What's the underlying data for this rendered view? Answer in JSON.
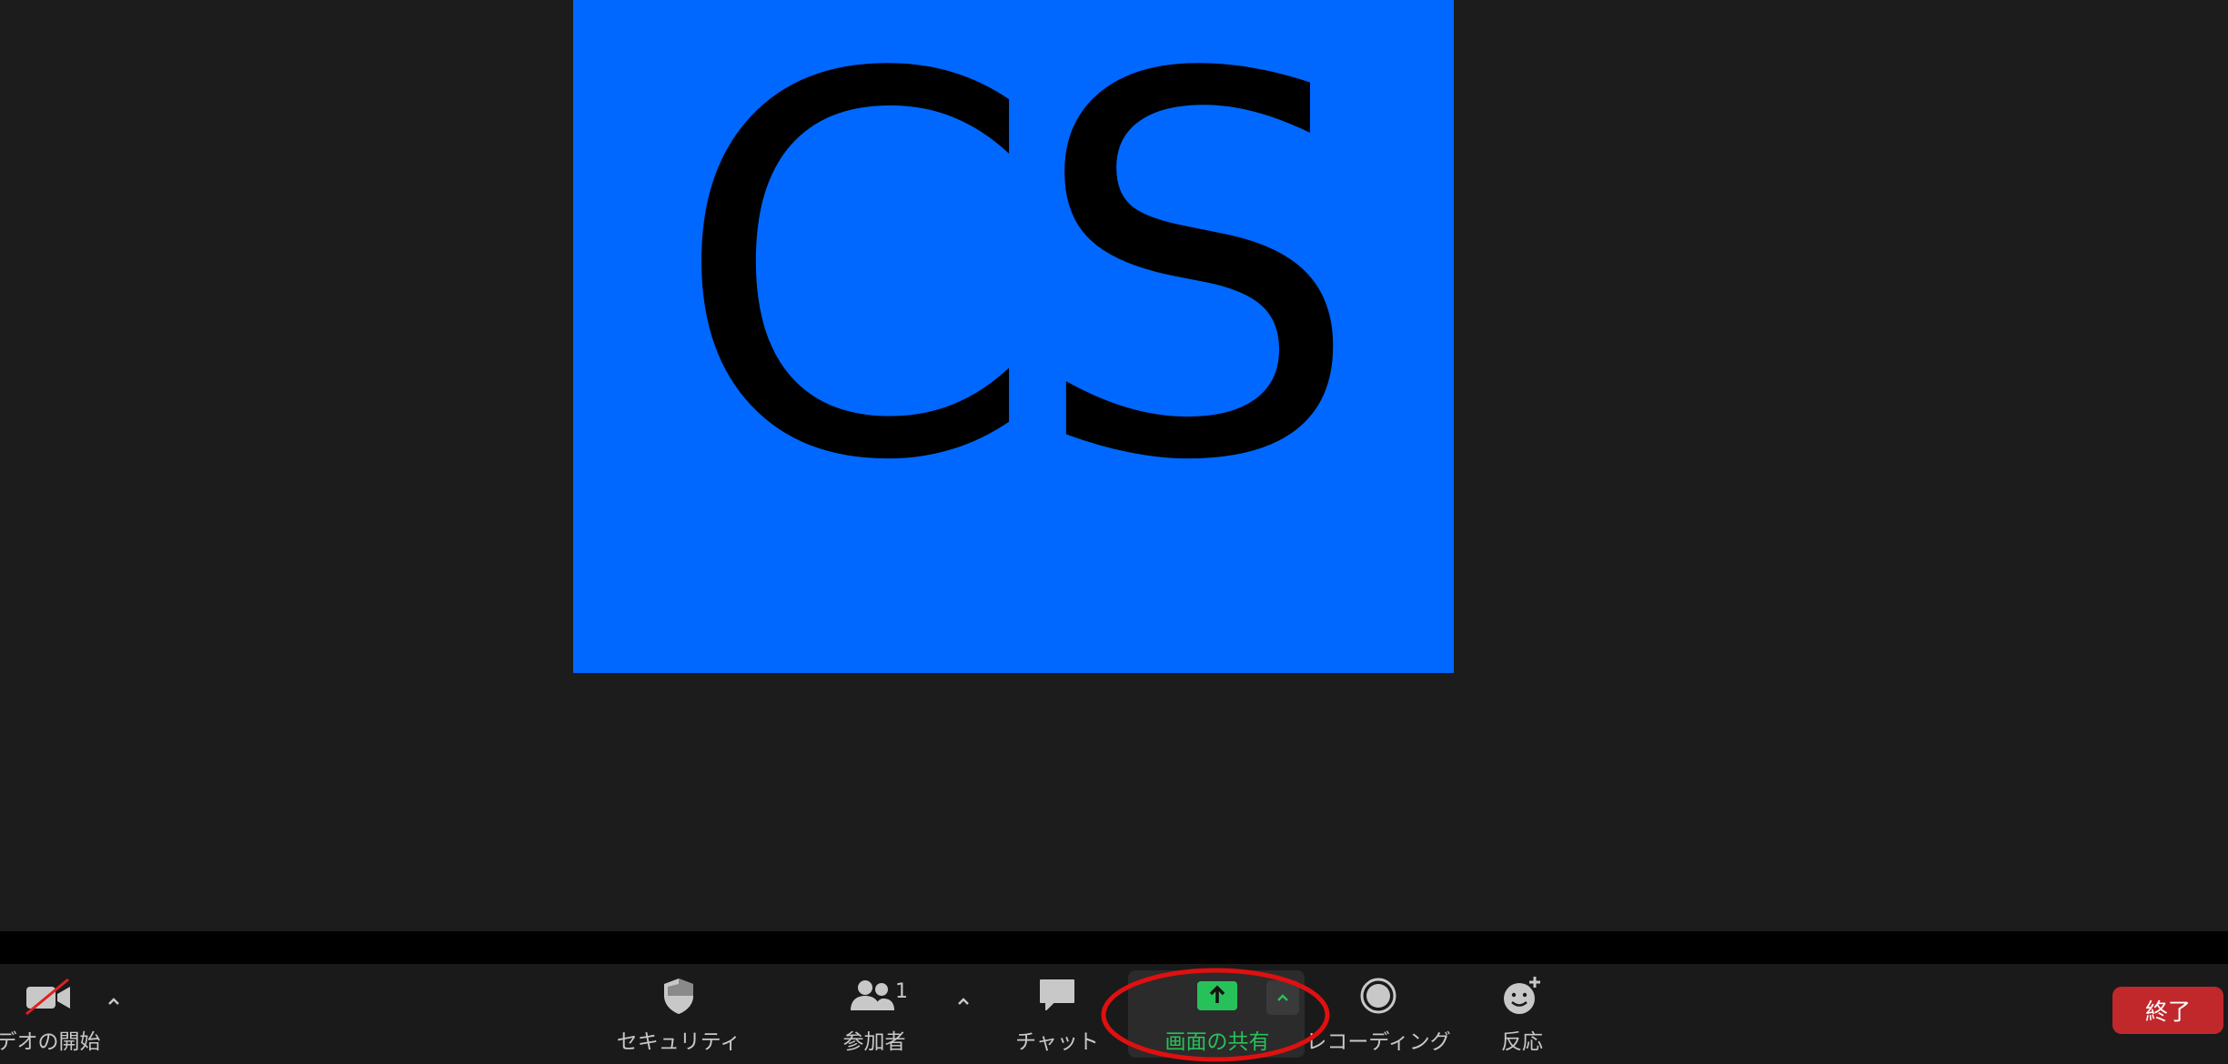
{
  "participant_tile": {
    "initials": "CS",
    "color": "#0068ff"
  },
  "toolbar": {
    "video": {
      "label": "デオの開始",
      "icon": "video-off-icon"
    },
    "security": {
      "label": "セキュリティ",
      "icon": "shield-icon"
    },
    "participants": {
      "label": "参加者",
      "count": "1",
      "icon": "people-icon"
    },
    "chat": {
      "label": "チャット",
      "icon": "chat-bubble-icon"
    },
    "share": {
      "label": "画面の共有",
      "icon": "share-screen-icon",
      "color": "#27c15a"
    },
    "record": {
      "label": "レコーディング",
      "icon": "record-icon"
    },
    "reactions": {
      "label": "反応",
      "icon": "emoji-add-icon"
    },
    "end": {
      "label": "終了",
      "color": "#c0282b"
    }
  },
  "annotation": {
    "highlight_color": "#e01010"
  }
}
